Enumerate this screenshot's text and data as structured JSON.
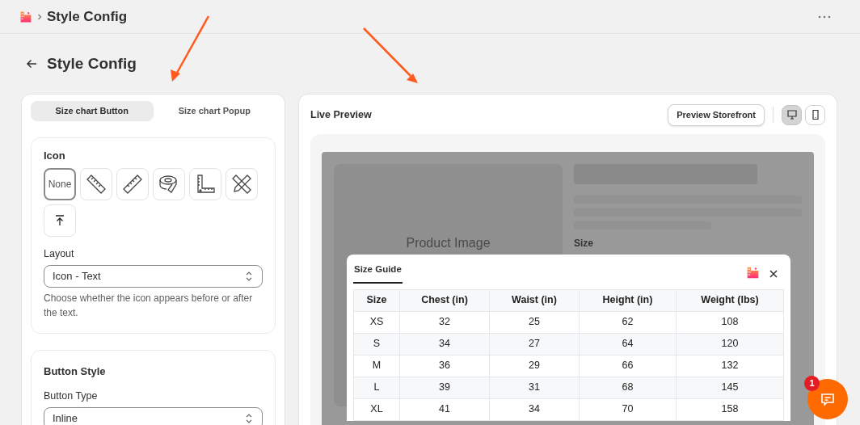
{
  "breadcrumb": {
    "title": "Style Config"
  },
  "page": {
    "title": "Style Config"
  },
  "tabs": [
    {
      "label": "Size chart Button",
      "selected": true
    },
    {
      "label": "Size chart Popup",
      "selected": false
    }
  ],
  "icon_section": {
    "title": "Icon",
    "options": [
      {
        "kind": "none",
        "label": "None",
        "selected": true
      },
      {
        "kind": "ruler-down",
        "selected": false
      },
      {
        "kind": "ruler-up",
        "selected": false
      },
      {
        "kind": "tape",
        "selected": false
      },
      {
        "kind": "square-ruler",
        "selected": false
      },
      {
        "kind": "crossed-tools",
        "selected": false
      },
      {
        "kind": "upload",
        "selected": false
      }
    ],
    "layout": {
      "label": "Layout",
      "value": "Icon - Text",
      "help": "Choose whether the icon appears before or after the text."
    }
  },
  "button_style": {
    "title": "Button Style",
    "button_type": {
      "label": "Button Type",
      "value": "Inline"
    }
  },
  "preview": {
    "title": "Live Preview",
    "storefront_button": "Preview Storefront",
    "devices": [
      {
        "kind": "desktop",
        "selected": true
      },
      {
        "kind": "mobile",
        "selected": false
      }
    ],
    "product_image": "Product Image",
    "size_label": "Size",
    "size_guide": {
      "title": "Size Guide",
      "columns": [
        "Size",
        "Chest (in)",
        "Waist (in)",
        "Height (in)",
        "Weight (lbs)"
      ],
      "rows": [
        [
          "XS",
          "32",
          "25",
          "62",
          "108"
        ],
        [
          "S",
          "34",
          "27",
          "64",
          "120"
        ],
        [
          "M",
          "36",
          "29",
          "66",
          "132"
        ],
        [
          "L",
          "39",
          "31",
          "68",
          "145"
        ],
        [
          "XL",
          "41",
          "34",
          "70",
          "158"
        ]
      ]
    }
  },
  "chat": {
    "badge": "1"
  }
}
